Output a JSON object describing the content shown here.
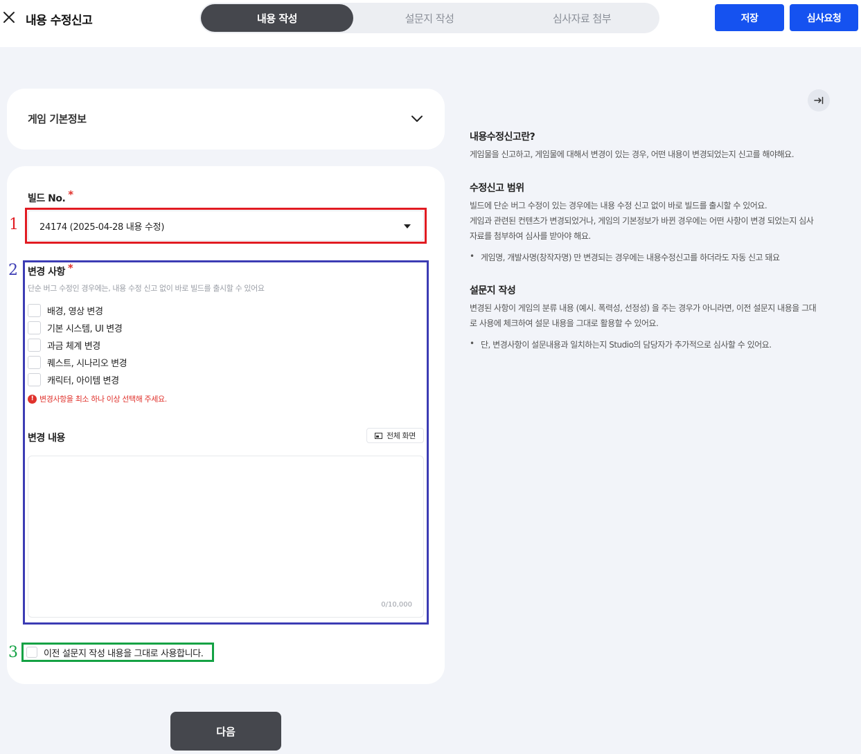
{
  "header": {
    "title": "내용 수정신고",
    "steps": [
      "내용 작성",
      "설문지 작성",
      "심사자료 첨부"
    ],
    "active_step": 0,
    "save_label": "저장",
    "submit_label": "심사요청"
  },
  "basic_info": {
    "label": "게임 기본정보"
  },
  "form": {
    "build_label": "빌드 No.",
    "required_mark": "*",
    "build_value": "24174 (2025-04-28 내용 수정)",
    "changes_label": "변경 사항",
    "changes_hint": "단순 버그 수정인 경우에는, 내용 수정 신고 없이 바로 빌드를 출시할 수 있어요",
    "options": [
      "배경, 영상 변경",
      "기본 시스템, UI 변경",
      "과금 체계 변경",
      "퀘스트, 시나리오 변경",
      "캐릭터, 아이템 변경"
    ],
    "error": "변경사항을 최소 하나 이상 선택해 주세요.",
    "content_label": "변경 내용",
    "fullscreen_label": "전체 화면",
    "counter": "0/10,000",
    "reuse_label": "이전 설문지 작성 내용을 그대로 사용합니다.",
    "next_label": "다음"
  },
  "annotations": {
    "n1": "1",
    "n2": "2",
    "n3": "3"
  },
  "info": {
    "s1_title": "내용수정신고란?",
    "s1_text": "게임물을 신고하고, 게임물에 대해서 변경이 있는 경우, 어떤 내용이 변경되었는지 신고를 해야해요.",
    "s2_title": "수정신고 범위",
    "s2_line1": "빌드에 단순 버그 수정이 있는 경우에는 내용 수정 신고 없이 바로 빌드를 출시할 수 있어요.",
    "s2_line2": "게임과 관련된 컨텐츠가 변경되었거나, 게임의 기본정보가 바뀐 경우에는 어떤 사항이 변경 되었는지 심사",
    "s2_line3": "자료를 첨부하여 심사를 받아야 해요.",
    "s2_bullet": "게임명, 개발사명(창작자명) 만 변경되는 경우에는 내용수정신고를 하더라도 자동 신고 돼요",
    "s3_title": "설문지 작성",
    "s3_line1": "변경된 사항이 게임의 분류 내용 (예시. 폭력성, 선정성) 을 주는 경우가 아니라면, 이전 설문지 내용을 그대",
    "s3_line2": "로 사용에 체크하여 설문 내용을 그대로 활용할 수 있어요.",
    "s3_bullet": "단, 변경사항이 설문내용과 일치하는지 Studio의 담당자가 추가적으로 심사할 수 있어요."
  },
  "colors": {
    "accent": "#1552f0",
    "dark": "#45474d",
    "error": "#e0322c",
    "annot_red": "#e11b22",
    "annot_blue": "#3c3cb4",
    "annot_green": "#14a244"
  },
  "icons": {
    "close": "close-icon",
    "chevron": "chevron-down-icon",
    "collapse": "collapse-panel-icon",
    "fullscreen": "fullscreen-icon",
    "error": "error-icon"
  }
}
